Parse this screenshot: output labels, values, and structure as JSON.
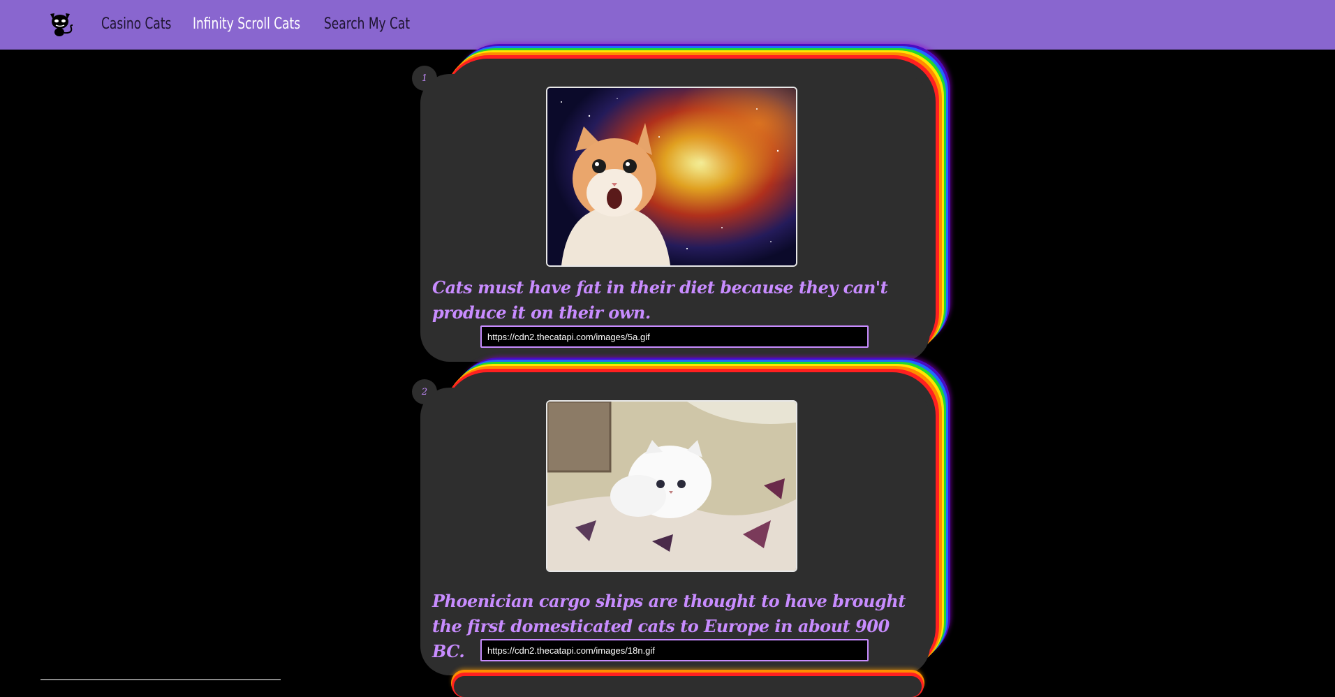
{
  "nav": {
    "links": [
      "Casino Cats",
      "Infinity Scroll Cats",
      "Search My Cat"
    ],
    "active_index": 1
  },
  "cards": [
    {
      "number": "1",
      "fact": "Cats must have fat in their diet because they can't produce it on their own.",
      "url": "https://cdn2.thecatapi.com/images/5a.gif",
      "image_subject": "orange-cat-space-background"
    },
    {
      "number": "2",
      "fact": "Phoenician cargo ships are thought to have brought the first domesticated cats to Europe in about 900 BC.",
      "url": "https://cdn2.thecatapi.com/images/18n.gif",
      "image_subject": "white-fluffy-kitten-on-blanket"
    }
  ],
  "colors": {
    "header": "#8966cf",
    "card": "#2e2e2e",
    "fact_text": "#c88cff",
    "background": "#000000"
  }
}
